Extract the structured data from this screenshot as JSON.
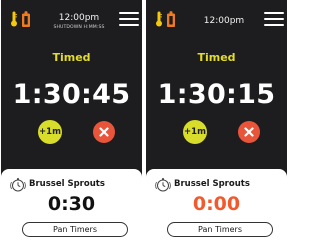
{
  "colors": {
    "accent_yellow": "#e3dc2a",
    "button_yellow": "#d8dc2a",
    "cancel_red": "#e8553b",
    "expired_orange": "#f05a2c",
    "screen_bg": "#1d1d1f",
    "thermometer_yellow": "#f3c80f",
    "tag_orange": "#ee7b22"
  },
  "screens": [
    {
      "status_bar": {
        "time": "12:00pm",
        "subtitle": "SHUTDOWN H:MM:SS",
        "icons": [
          "thermometer-icon",
          "tag-icon",
          "hamburger-menu-icon"
        ]
      },
      "mode_label": "Timed",
      "countdown": "1:30:45",
      "add_button_label": "+1m",
      "cancel_icon": "close-icon",
      "pan_card": {
        "icon": "timer-icon",
        "item_name": "Brussel Sprouts",
        "time_remaining": "0:30",
        "button_label": "Pan Timers"
      }
    },
    {
      "status_bar": {
        "time": "12:00pm",
        "icons": [
          "thermometer-icon",
          "tag-icon",
          "hamburger-menu-icon"
        ]
      },
      "mode_label": "Timed",
      "countdown": "1:30:15",
      "add_button_label": "+1m",
      "cancel_icon": "close-icon",
      "pan_card": {
        "icon": "timer-icon",
        "item_name": "Brussel Sprouts",
        "time_remaining": "0:00",
        "button_label": "Pan Timers"
      }
    }
  ]
}
